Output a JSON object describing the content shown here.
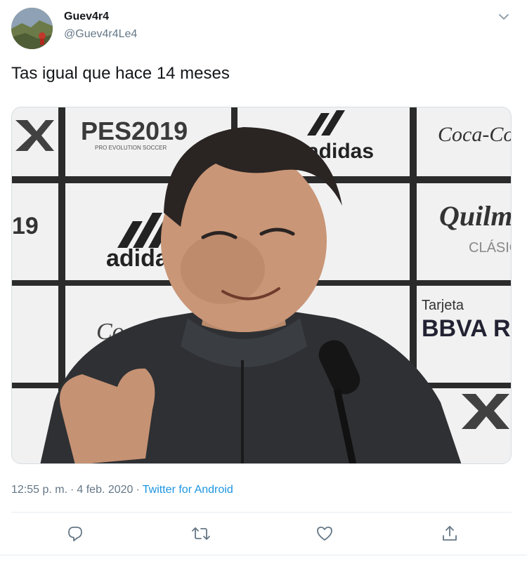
{
  "tweet": {
    "author_name": "Guev4r4",
    "author_handle": "@Guev4r4Le4",
    "text": "Tas igual que hace 14 meses",
    "time": "12:55 p. m.",
    "separator": "·",
    "date": "4 feb. 2020",
    "source": "Twitter for Android"
  },
  "media": {
    "backdrop_brands": [
      "PES2019",
      "PRO EVOLUTION SOCCER",
      "adidas",
      "Coca-Cola",
      "Quilmes",
      "CLÁSICA",
      "Tarjeta",
      "BBVA R",
      "19"
    ]
  },
  "icons": {
    "menu": "chevron-down-icon",
    "reply": "reply-icon",
    "retweet": "retweet-icon",
    "like": "heart-icon",
    "share": "share-icon"
  },
  "colors": {
    "link": "#1b95e0",
    "secondary_text": "#657786",
    "icon": "#657786"
  }
}
